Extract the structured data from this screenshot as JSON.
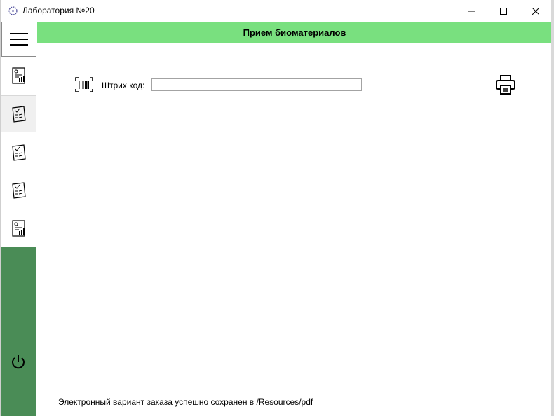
{
  "window": {
    "title": "Лаборатория №20",
    "icons": {
      "app": "flask-icon",
      "minimize": "minimize-icon",
      "maximize": "maximize-icon",
      "close": "close-icon"
    }
  },
  "sidebar": {
    "menu_icon": "hamburger-menu-icon",
    "items": [
      {
        "icon": "report-chart-icon",
        "selected": false
      },
      {
        "icon": "checklist-icon",
        "selected": true
      },
      {
        "icon": "checklist-icon",
        "selected": false
      },
      {
        "icon": "checklist-icon",
        "selected": false
      },
      {
        "icon": "report-chart-icon",
        "selected": false
      }
    ],
    "power_icon": "power-icon"
  },
  "header": {
    "title": "Прием биоматериалов"
  },
  "form": {
    "barcode_label": "Штрих код:",
    "barcode_value": "",
    "barcode_icon": "barcode-icon",
    "print_icon": "printer-icon"
  },
  "status": {
    "message": "Электронный вариант заказа успешно сохранен в /Resources/pdf"
  },
  "colors": {
    "header_bg": "#79e07f",
    "sidebar_bg": "#4a8c56"
  }
}
